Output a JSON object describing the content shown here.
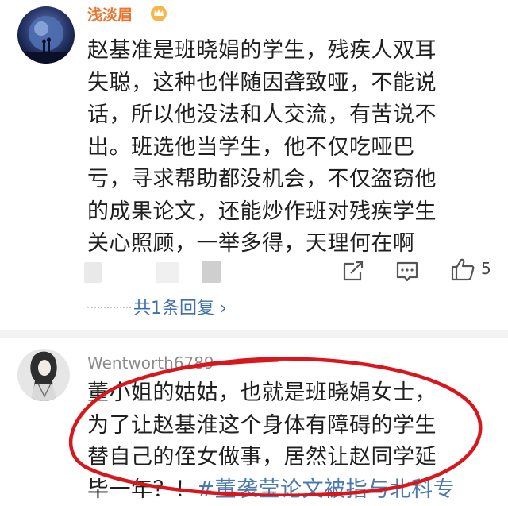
{
  "comments": [
    {
      "username": "浅淡眉",
      "badge": "crown-vip-icon",
      "lines": [
        "赵基准是班晓娟的学生，残疾人双耳",
        "失聪，这种也伴随因聋致哑，不能说",
        "话，所以他没法和人交流，有苦说不",
        "出。班选他当学生，他不仅吃哑巴",
        "亏，寻求帮助都没机会，不仅盗窃他",
        "的成果论文，还能炒作班对残疾学生",
        "关心照顾，一举多得，天理何在啊"
      ],
      "likes": "5",
      "replies": "共1条回复 ›"
    },
    {
      "username": "Wentworth6789",
      "lines": [
        "董小姐的姑姑，也就是班晓娟女士，",
        "为了让赵基淮这个身体有障碍的学生",
        "替自己的侄女做事，居然让赵同学延"
      ],
      "last_line_text": "毕一年？！",
      "topic": "#董袭莹论文被指与北科专"
    }
  ],
  "colors": {
    "username_vip": "#e8762d",
    "username_normal": "#8a8a8a",
    "link": "#3e6fae",
    "annotation": "#d9161c"
  }
}
